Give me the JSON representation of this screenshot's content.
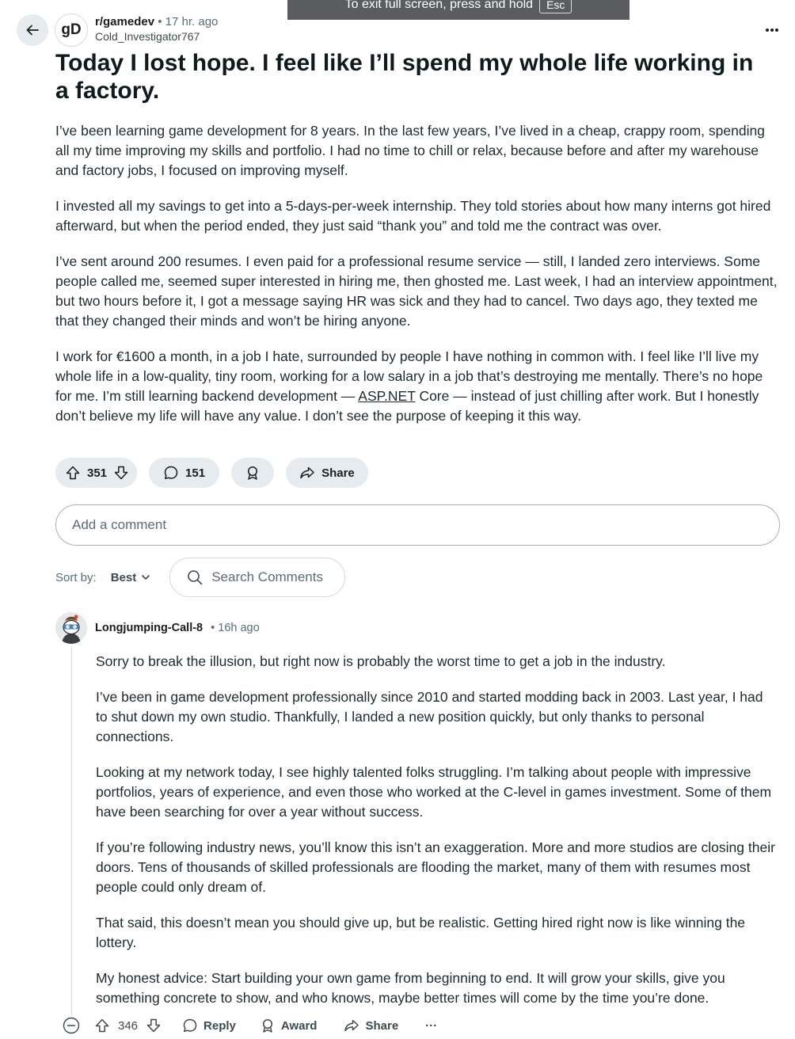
{
  "banner": {
    "text": "To exit full screen, press and hold",
    "key": "Esc"
  },
  "post": {
    "subreddit": "r/gamedev",
    "subreddit_avatar": "gD",
    "separator": "•",
    "age": "17 hr. ago",
    "author": "Cold_Investigator767",
    "title": "Today I lost hope. I feel like I’ll spend my whole life working in a factory.",
    "paragraphs": [
      "I’ve been learning game development for 8 years. In the last few years, I’ve lived in a cheap, crappy room, spending all my time improving my skills and portfolio. I had no time to chill or relax, because before and after my warehouse and factory jobs, I focused on improving myself.",
      "I invested all my savings to get into a 5-days-per-week internship. They told stories about how many interns got hired afterward, but when the period ended, they just said “thank you” and told me the contract was over.",
      "I’ve sent around 200 resumes. I even paid for a professional resume service — still, I landed zero interviews. Some people called me, seemed super interested in hiring me, then ghosted me. Last week, I had an interview appointment, but two hours before it, I got a message saying HR was sick and they had to cancel. Two days ago, they texted me that they changed their minds and won’t be hiring anyone."
    ],
    "last_paragraph": {
      "before": "I work for €1600 a month, in a job I hate, surrounded by people I have nothing in common with. I feel like I’ll live my whole life in a low-quality, tiny room, working for a low salary in a job that’s destroying me mentally. There’s no hope for me. I’m still learning backend development — ",
      "link": "ASP.NET",
      "after": " Core — instead of just chilling after work. But I honestly don’t believe my life will have any value. I don’t see the purpose of keeping it this way."
    },
    "votes": "351",
    "comments": "151",
    "share_label": "Share"
  },
  "comment_box": {
    "placeholder": "Add a comment"
  },
  "sort": {
    "label": "Sort by:",
    "value": "Best",
    "search_placeholder": "Search Comments"
  },
  "comment": {
    "user": "Longjumping-Call-8",
    "age": "• 16h ago",
    "paragraphs": [
      "Sorry to break the illusion, but right now is probably the worst time to get a job in the industry.",
      "I’ve been in game development professionally since 2010 and started modding back in 2003. Last year, I had to shut down my own studio. Thankfully, I landed a new position quickly, but only thanks to personal connections.",
      "Looking at my network today, I see highly talented folks struggling. I’m talking about people with impressive portfolios, years of experience, and even those who worked at the C-level in games investment. Some of them have been searching for over a year without success.",
      "If you’re following industry news, you’ll know this isn’t an exaggeration. More and more studios are closing their doors. Tens of thousands of skilled professionals are flooding the market, many of them with resumes most people could only dream of.",
      "That said, this doesn’t mean you should give up, but be realistic. Getting hired right now is like winning the lottery.",
      "My honest advice: Start building your own game from beginning to end. It will grow your skills, give you something concrete to show, and who knows, maybe better times will come by the time you’re done."
    ],
    "votes": "346",
    "reply_label": "Reply",
    "award_label": "Award",
    "share_label": "Share",
    "more": "···"
  },
  "icons": {
    "back": "arrow-left-icon",
    "more": "ellipsis-icon",
    "upvote": "arrow-up-icon",
    "downvote": "arrow-down-icon",
    "comment": "speech-bubble-icon",
    "award": "award-icon",
    "share": "share-arrow-icon",
    "search": "magnifier-icon",
    "chevron": "chevron-down-icon",
    "collapse": "minus-circle-icon"
  }
}
